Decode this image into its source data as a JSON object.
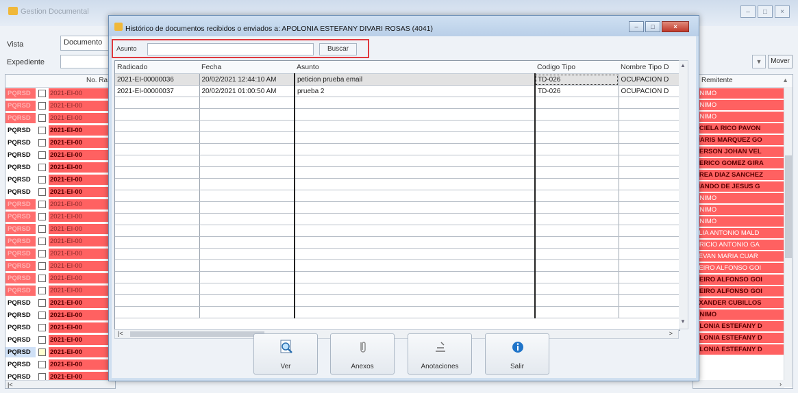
{
  "background_window": {
    "title": "Gestion Documental",
    "vista_label": "Vista",
    "vista_value": "Documento",
    "expediente_label": "Expediente",
    "mover_label": "Mover",
    "left_grid_header": "No. Ra",
    "right_grid_header": "Remitente",
    "left_rows": [
      {
        "type": "PQRSD",
        "num": "2021-EI-00",
        "style": "faded"
      },
      {
        "type": "PQRSD",
        "num": "2021-EI-00",
        "style": "faded"
      },
      {
        "type": "PQRSD",
        "num": "2021-EI-00",
        "style": "faded"
      },
      {
        "type": "PQRSD",
        "num": "2021-EI-00",
        "style": "plain"
      },
      {
        "type": "PQRSD",
        "num": "2021-EI-00",
        "style": "plain"
      },
      {
        "type": "PQRSD",
        "num": "2021-EI-00",
        "style": "plain"
      },
      {
        "type": "PQRSD",
        "num": "2021-EI-00",
        "style": "plain"
      },
      {
        "type": "PQRSD",
        "num": "2021-EI-00",
        "style": "plain"
      },
      {
        "type": "PQRSD",
        "num": "2021-EI-00",
        "style": "plain"
      },
      {
        "type": "PQRSD",
        "num": "2021-EI-00",
        "style": "faded"
      },
      {
        "type": "PQRSD",
        "num": "2021-EI-00",
        "style": "faded"
      },
      {
        "type": "PQRSD",
        "num": "2021-EI-00",
        "style": "faded"
      },
      {
        "type": "PQRSD",
        "num": "2021-EI-00",
        "style": "faded"
      },
      {
        "type": "PQRSD",
        "num": "2021-EI-00",
        "style": "faded"
      },
      {
        "type": "PQRSD",
        "num": "2021-EI-00",
        "style": "faded"
      },
      {
        "type": "PQRSD",
        "num": "2021-EI-00",
        "style": "faded"
      },
      {
        "type": "PQRSD",
        "num": "2021-EI-00",
        "style": "faded"
      },
      {
        "type": "PQRSD",
        "num": "2021-EI-00",
        "style": "plain"
      },
      {
        "type": "PQRSD",
        "num": "2021-EI-00",
        "style": "plain"
      },
      {
        "type": "PQRSD",
        "num": "2021-EI-00",
        "style": "plain"
      },
      {
        "type": "PQRSD",
        "num": "2021-EI-00",
        "style": "plain"
      },
      {
        "type": "PQRSD",
        "num": "2021-EI-00",
        "style": "sel"
      },
      {
        "type": "PQRSD",
        "num": "2021-EI-00",
        "style": "plain"
      },
      {
        "type": "PQRSD",
        "num": "2021-EI-00",
        "style": "plain"
      }
    ],
    "right_rows": [
      {
        "name": "ONIMO",
        "style": "faded"
      },
      {
        "name": "ONIMO",
        "style": "faded"
      },
      {
        "name": "ONIMO",
        "style": "faded"
      },
      {
        "name": "ACIELA RICO PAVON",
        "style": "plain"
      },
      {
        "name": "MARIS MARQUEZ GO",
        "style": "plain"
      },
      {
        "name": "DERSON JOHAN VEL",
        "style": "plain"
      },
      {
        "name": "DERICO GOMEZ GIRA",
        "style": "plain"
      },
      {
        "name": "DREA DIAZ SANCHEZ",
        "style": "plain"
      },
      {
        "name": "MANDO DE JESUS G",
        "style": "plain"
      },
      {
        "name": "ONIMO",
        "style": "faded"
      },
      {
        "name": "ONIMO",
        "style": "faded"
      },
      {
        "name": "ONIMO",
        "style": "faded"
      },
      {
        "name": "ELIA ANTONIO MALD",
        "style": "faded"
      },
      {
        "name": "URICIO ANTONIO GA",
        "style": "faded"
      },
      {
        "name": "TEVAN MARIA CUAR",
        "style": "faded"
      },
      {
        "name": "BEIRO ALFONSO GOI",
        "style": "faded"
      },
      {
        "name": "BEIRO ALFONSO GOI",
        "style": "plain"
      },
      {
        "name": "BEIRO ALFONSO GOI",
        "style": "plain"
      },
      {
        "name": "EXANDER CUBILLOS",
        "style": "plain"
      },
      {
        "name": "ONIMO",
        "style": "plain"
      },
      {
        "name": "OLONIA ESTEFANY D",
        "style": "plain"
      },
      {
        "name": "OLONIA ESTEFANY D",
        "style": "plain"
      },
      {
        "name": "OLONIA ESTEFANY D",
        "style": "plain"
      }
    ]
  },
  "dialog": {
    "title": "Histórico de documentos recibidos o enviados a: APOLONIA ESTEFANY DIVARI ROSAS (4041)",
    "search": {
      "label": "Asunto",
      "value": "",
      "button_label": "Buscar"
    },
    "columns": [
      "Radicado",
      "Fecha",
      "Asunto",
      "Codigo Tipo",
      "Nombre Tipo D"
    ],
    "rows": [
      {
        "radicado": "2021-EI-00000036",
        "fecha": "20/02/2021 12:44:10 AM",
        "asunto": "peticion prueba email",
        "codigo": "TD-026",
        "nombre": "OCUPACION D"
      },
      {
        "radicado": "2021-EI-00000037",
        "fecha": "20/02/2021 01:00:50 AM",
        "asunto": "prueba 2",
        "codigo": "TD-026",
        "nombre": "OCUPACION D"
      }
    ],
    "empty_row_count": 19,
    "actions": [
      {
        "label": "Ver",
        "icon": "magnifier-document-icon"
      },
      {
        "label": "Anexos",
        "icon": "paperclip-icon"
      },
      {
        "label": "Anotaciones",
        "icon": "note-icon"
      },
      {
        "label": "Salir",
        "icon": "info-icon"
      }
    ]
  }
}
